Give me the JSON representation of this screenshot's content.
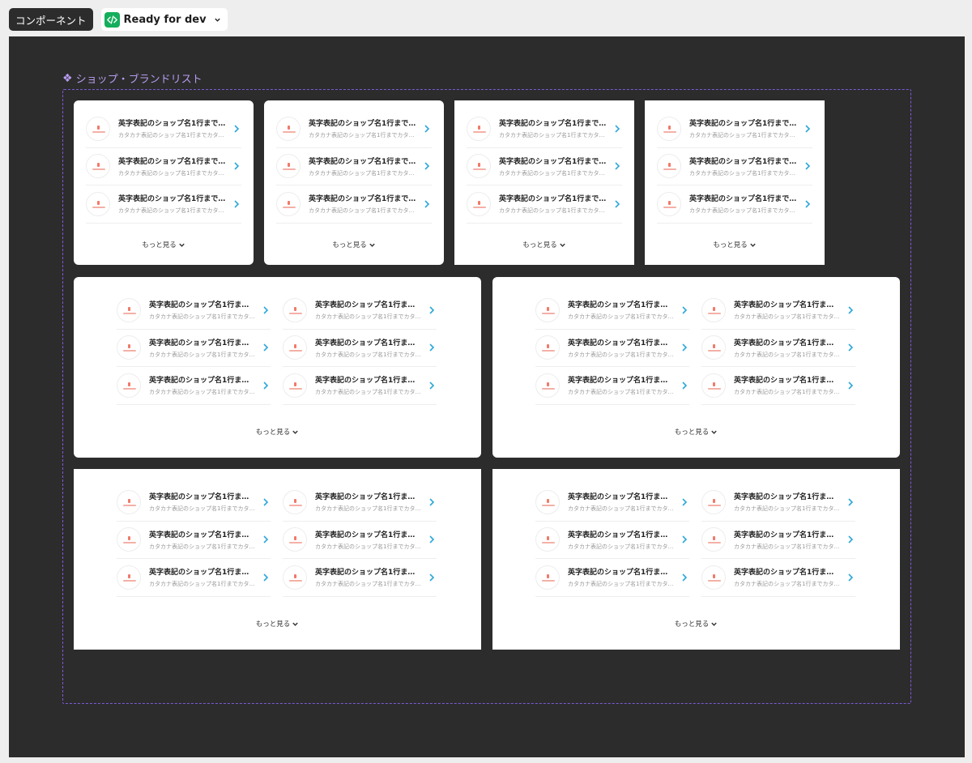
{
  "toolbar": {
    "component_tag": "コンポーネント",
    "status_label": "Ready for dev"
  },
  "component": {
    "title": "ショップ・ブランドリスト"
  },
  "item": {
    "name": "英字表記のショップ名1行までで…",
    "kana": "カタカナ表記のショップ名1行までカタカナ…"
  },
  "more_label": "もっと見る",
  "colors": {
    "canvas": "#2c2c2c",
    "accent_chevron": "#2ea7d8",
    "component_purple": "#b79cf0",
    "dev_green": "#14ae5c"
  }
}
